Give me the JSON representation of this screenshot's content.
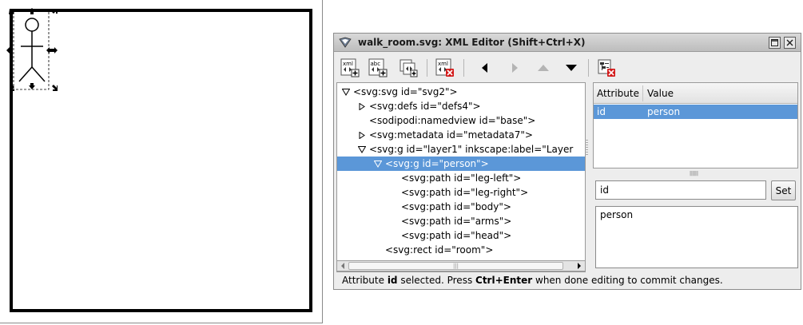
{
  "window": {
    "title": "walk_room.svg: XML Editor (Shift+Ctrl+X)",
    "maximize_icon": "maximize-icon",
    "close_icon": "close-icon"
  },
  "toolbar": {
    "buttons": [
      {
        "name": "new-element-node-button",
        "icon": "xml-new-element-icon",
        "glyph": "xml"
      },
      {
        "name": "new-text-node-button",
        "icon": "abc-new-text-icon",
        "glyph": "abc"
      },
      {
        "name": "duplicate-node-button",
        "icon": "duplicate-node-icon",
        "glyph": ""
      },
      {
        "name": "delete-node-button",
        "icon": "xml-delete-icon",
        "glyph": "xml"
      },
      {
        "name": "unindent-node-button",
        "icon": "arrow-left-icon"
      },
      {
        "name": "indent-node-button",
        "icon": "arrow-right-icon"
      },
      {
        "name": "raise-node-button",
        "icon": "arrow-up-icon"
      },
      {
        "name": "lower-node-button",
        "icon": "arrow-down-icon"
      },
      {
        "name": "delete-attribute-button",
        "icon": "delete-attribute-icon"
      }
    ]
  },
  "tree": {
    "nodes": [
      {
        "label": "<svg:svg id=\"svg2\">",
        "depth": 0,
        "expander": "open"
      },
      {
        "label": "<svg:defs id=\"defs4\">",
        "depth": 1,
        "expander": "closed"
      },
      {
        "label": "<sodipodi:namedview id=\"base\">",
        "depth": 1,
        "expander": "none"
      },
      {
        "label": "<svg:metadata id=\"metadata7\">",
        "depth": 1,
        "expander": "closed"
      },
      {
        "label": "<svg:g id=\"layer1\" inkscape:label=\"Layer",
        "depth": 1,
        "expander": "open"
      },
      {
        "label": "<svg:g id=\"person\">",
        "depth": 2,
        "expander": "open",
        "selected": true
      },
      {
        "label": "<svg:path id=\"leg-left\">",
        "depth": 3,
        "expander": "none"
      },
      {
        "label": "<svg:path id=\"leg-right\">",
        "depth": 3,
        "expander": "none"
      },
      {
        "label": "<svg:path id=\"body\">",
        "depth": 3,
        "expander": "none"
      },
      {
        "label": "<svg:path id=\"arms\">",
        "depth": 3,
        "expander": "none"
      },
      {
        "label": "<svg:path id=\"head\">",
        "depth": 3,
        "expander": "none"
      },
      {
        "label": "<svg:rect id=\"room\">",
        "depth": 2,
        "expander": "none"
      }
    ]
  },
  "attributes": {
    "col_attribute": "Attribute",
    "col_value": "Value",
    "rows": [
      {
        "name": "id",
        "value": "person"
      }
    ],
    "name_input": "id",
    "set_label": "Set",
    "value_input": "person"
  },
  "status": {
    "prefix": "Attribute ",
    "attr": "id",
    "middle": " selected. Press ",
    "shortcut": "Ctrl+Enter",
    "suffix": " when done editing to commit changes."
  },
  "colors": {
    "selection": "#5b97d8"
  }
}
